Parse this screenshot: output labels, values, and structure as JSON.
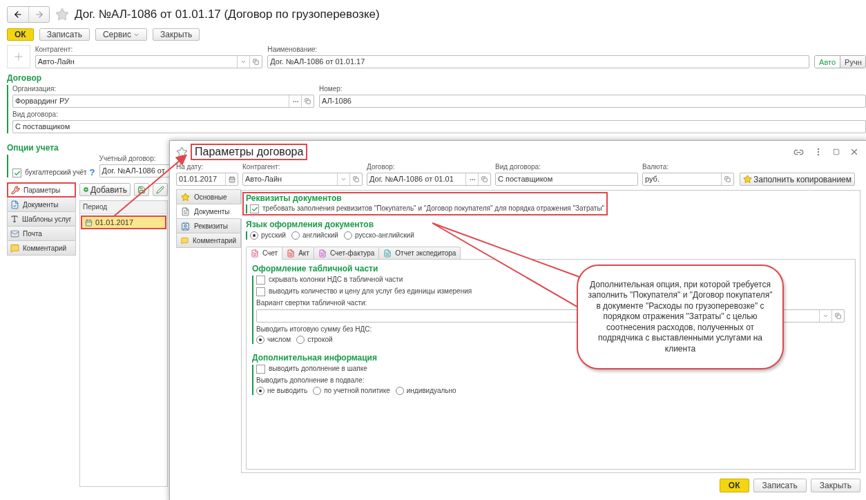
{
  "window": {
    "title": "Дог. №АЛ-1086 от 01.01.17 (Договор по грузоперевозке)"
  },
  "toolbar": [
    {
      "label": "ОК",
      "kind": "primary"
    },
    {
      "label": "Записать",
      "kind": "plain"
    },
    {
      "label": "Сервис",
      "kind": "menu"
    },
    {
      "label": "Закрыть",
      "kind": "plain"
    }
  ],
  "header": {
    "counterparty": {
      "label": "Контрагент:",
      "value": "Авто-Лайн"
    },
    "name": {
      "label": "Наименование:",
      "value": "Дог. №АЛ-1086 от 01.01.17"
    },
    "name_mode": [
      {
        "label": "Авто",
        "selected": true
      },
      {
        "label": "Ручн",
        "selected": false
      }
    ]
  },
  "contract": {
    "title": "Договор",
    "organization": {
      "label": "Организация:",
      "value": "Форвардинг РУ"
    },
    "number": {
      "label": "Номер:",
      "value": "АЛ-1086"
    },
    "contract_type": {
      "label": "Вид договора:",
      "value": "С поставщиком"
    }
  },
  "accounting": {
    "title": "Опции учета",
    "checkbox": {
      "label": "бухгалтерский учёт",
      "checked": true
    },
    "help": "?",
    "account_contract": {
      "label": "Учетный договор:",
      "value": "Дог. №АЛ-1086 от"
    }
  },
  "side_tabs": [
    {
      "label": "Параметры",
      "selected": true,
      "highlighted": true
    },
    {
      "label": "Документы",
      "selected": false,
      "highlighted": false
    },
    {
      "label": "Шаблоны услуг",
      "selected": false,
      "highlighted": false
    },
    {
      "label": "Почта",
      "selected": false,
      "highlighted": false
    },
    {
      "label": "Комментарий",
      "selected": false,
      "highlighted": false
    }
  ],
  "periods": {
    "add_button": "Добавить",
    "columns": [
      "Период"
    ],
    "rows": [
      {
        "period": "01.01.2017",
        "selected": true,
        "highlighted": true
      }
    ]
  },
  "dialog": {
    "title": "Параметры договора",
    "title_highlighted": true,
    "fields": {
      "date": {
        "label": "На дату:",
        "value": "01.01.2017"
      },
      "counterparty": {
        "label": "Контрагент:",
        "value": "Авто-Лайн"
      },
      "contract": {
        "label": "Договор:",
        "value": "Дог. №АЛ-1086 от 01.01"
      },
      "contract_type": {
        "label": "Вид договора:",
        "value": "С поставщиком"
      },
      "currency": {
        "label": "Валюта:",
        "value": "руб."
      }
    },
    "fill_button": "Заполнить копированием",
    "tabs": [
      {
        "label": "Основные",
        "selected": false
      },
      {
        "label": "Документы",
        "selected": true
      },
      {
        "label": "Реквизиты",
        "selected": false
      },
      {
        "label": "Комментарий",
        "selected": false
      }
    ],
    "requisites": {
      "title": "Реквизиты документов",
      "highlighted": true,
      "checkbox": {
        "label": "требовать заполнения реквизитов \"Покупатель\" и \"Договор покупателя\" для  порядка отражения \"Затраты\"",
        "checked": true
      }
    },
    "language": {
      "title": "Язык оформления документов",
      "options": [
        {
          "label": "русский",
          "selected": true
        },
        {
          "label": "английский",
          "selected": false
        },
        {
          "label": "русско-английский",
          "selected": false
        }
      ]
    },
    "doc_tabs": [
      {
        "label": "Счет",
        "selected": true
      },
      {
        "label": "Акт",
        "selected": false
      },
      {
        "label": "Счет-фактура",
        "selected": false
      },
      {
        "label": "Отчет экспедитора",
        "selected": false
      }
    ],
    "table_section": {
      "title": "Оформление табличной части",
      "checkboxes": [
        {
          "label": "скрывать колонки НДС в табличной части",
          "checked": false
        },
        {
          "label": "выводить количество и цену для услуг без единицы измерения",
          "checked": false
        }
      ],
      "rollup_label": "Вариант свертки табличной части:",
      "total_label": "Выводить итоговую сумму без НДС:",
      "total_options": [
        {
          "label": "числом",
          "selected": true
        },
        {
          "label": "строкой",
          "selected": false
        }
      ]
    },
    "extra_section": {
      "title": "Дополнительная информация",
      "checkboxes": [
        {
          "label": "выводить дополнение в шапке",
          "checked": false
        }
      ],
      "footer_label": "Выводить дополнение в подвале:",
      "footer_options": [
        {
          "label": "не выводить",
          "selected": true
        },
        {
          "label": "по учетной политике",
          "selected": false
        },
        {
          "label": "индивидуально",
          "selected": false
        }
      ]
    },
    "buttons": [
      {
        "label": "ОК",
        "kind": "primary"
      },
      {
        "label": "Записать",
        "kind": "plain"
      },
      {
        "label": "Закрыть",
        "kind": "plain"
      }
    ]
  },
  "callout": {
    "text": "Дополнительная опция, при которой требуется заполнить \"Покупателя\" и \"Договор покупателя\" в документе \"Расходы по грузоперевозке\" с порядком отражения \"Затраты\" с целью соотнесения расходов, полученных от подрядчика с выставленными услугами на клиента"
  }
}
